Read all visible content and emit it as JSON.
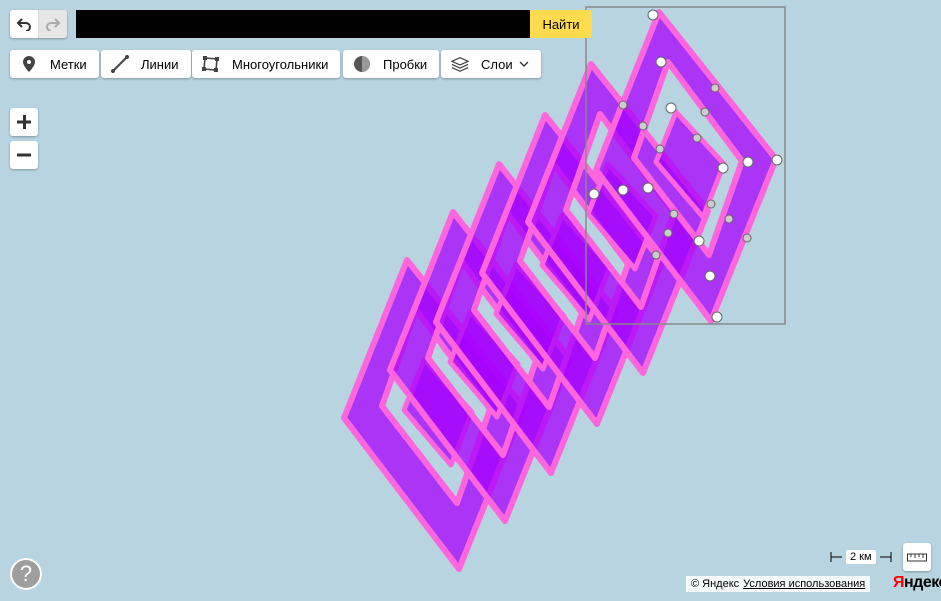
{
  "toolbar": {
    "undo_icon": "undo-icon",
    "redo_icon": "redo-icon",
    "search": {
      "value": "",
      "placeholder": ""
    },
    "find_label": "Найти"
  },
  "tools": {
    "placemarks": {
      "label": "Метки",
      "icon": "placemark-icon"
    },
    "lines": {
      "label": "Линии",
      "icon": "line-icon"
    },
    "polygons": {
      "label": "Многоугольники",
      "icon": "polygon-icon"
    },
    "traffic": {
      "label": "Пробки",
      "icon": "traffic-icon"
    },
    "layers": {
      "label": "Слои",
      "icon": "layers-icon"
    }
  },
  "zoom": {
    "in_icon": "plus-icon",
    "out_icon": "minus-icon"
  },
  "scale": {
    "label": "2 км"
  },
  "ruler_icon": "ruler-icon",
  "help_label": "?",
  "footer": {
    "copyright": "© Яндекс",
    "terms_link": "Условия использования",
    "logo_first": "Я",
    "logo_rest": "ндекс"
  },
  "colors": {
    "map_background": "#b7d4e0",
    "polygon_fill": "#a600ff",
    "polygon_stroke": "#ff66dd",
    "find_button": "#ffdb4d",
    "search_field": "#000000"
  }
}
